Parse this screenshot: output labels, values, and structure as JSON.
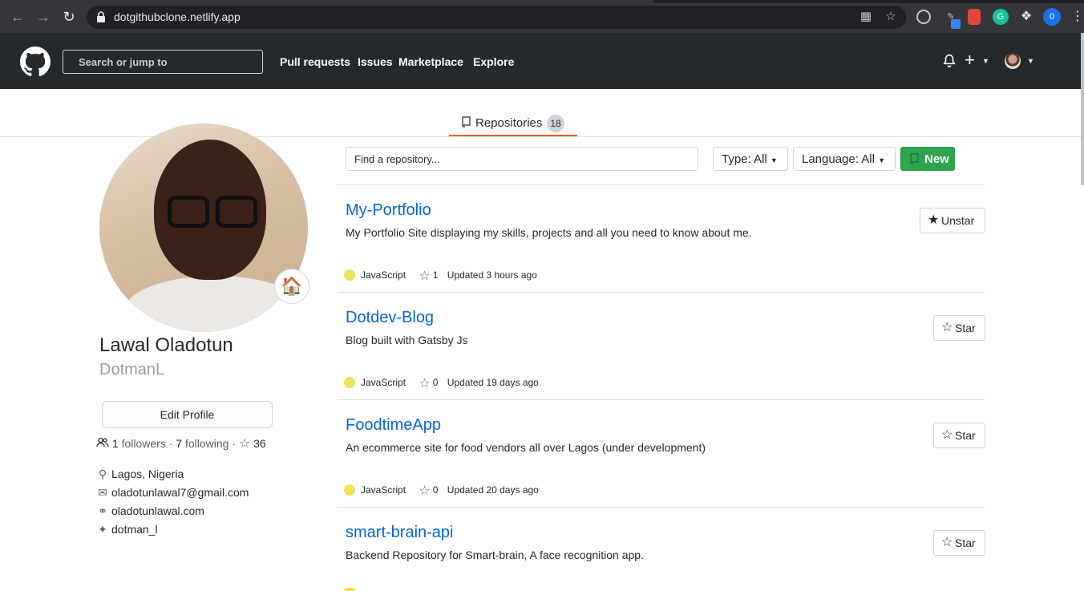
{
  "browser": {
    "url": "dotgithubclone.netlify.app",
    "profile_initial": "0"
  },
  "header": {
    "search_placeholder": "Search or jump to",
    "nav": [
      "Pull requests",
      "Issues",
      "Marketplace",
      "Explore"
    ]
  },
  "tabs": {
    "repositories_label": "Repositories",
    "repositories_count": "18"
  },
  "profile": {
    "status_emoji": "🏠",
    "full_name": "Lawal Oladotun",
    "username": "DotmanL",
    "edit_button": "Edit Profile",
    "followers_count": "1",
    "followers_label": "followers",
    "separator": "·",
    "following_count": "7",
    "following_label": "following",
    "stars_count": "36",
    "location": "Lagos, Nigeria",
    "email": "oladotunlawal7@gmail.com",
    "website": "oladotunlawal.com",
    "twitter": "dotman_l"
  },
  "filters": {
    "find_placeholder": "Find a repository...",
    "type_label": "Type: All",
    "language_label": "Language: All",
    "new_label": "New"
  },
  "colors": {
    "javascript": "#f1e05a",
    "link": "#0366d6",
    "new_button": "#2ea44f",
    "tab_underline": "#e36209"
  },
  "repos": [
    {
      "name": "My-Portfolio",
      "description": "My Portfolio Site displaying my skills, projects and all you need to know about me.",
      "language": "JavaScript",
      "stars": "1",
      "updated": "Updated 3 hours ago",
      "star_button": "Unstar",
      "starred": true
    },
    {
      "name": "Dotdev-Blog",
      "description": "Blog built with Gatsby Js",
      "language": "JavaScript",
      "stars": "0",
      "updated": "Updated 19 days ago",
      "star_button": "Star",
      "starred": false
    },
    {
      "name": "FoodtimeApp",
      "description": "An ecommerce site for food vendors all over Lagos (under development)",
      "language": "JavaScript",
      "stars": "0",
      "updated": "Updated 20 days ago",
      "star_button": "Star",
      "starred": false
    },
    {
      "name": "smart-brain-api",
      "description": "Backend Repository for Smart-brain, A face recognition app.",
      "star_button": "Star",
      "starred": false
    }
  ]
}
